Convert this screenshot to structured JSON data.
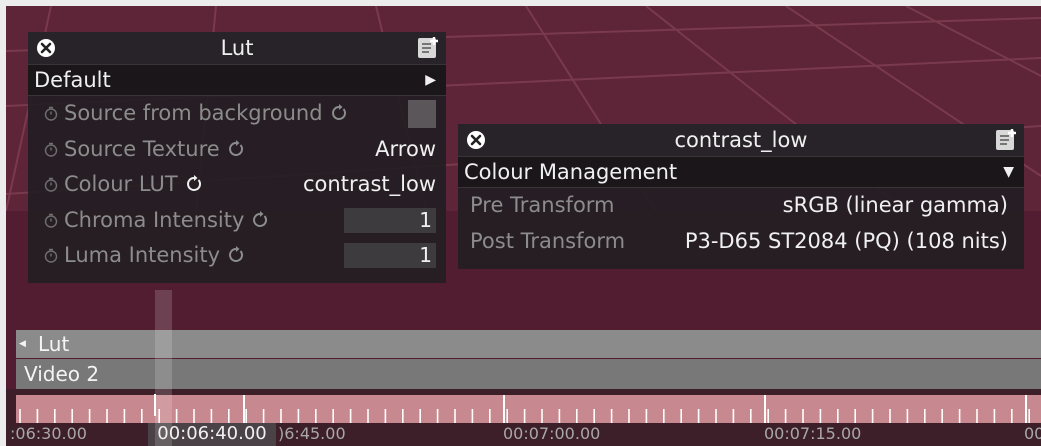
{
  "lut_panel": {
    "title": "Lut",
    "preset": "Default",
    "params": [
      {
        "label": "Source from background",
        "control": "checkbox",
        "checked": false
      },
      {
        "label": "Source Texture",
        "control": "text",
        "value": "Arrow"
      },
      {
        "label": "Colour LUT",
        "control": "text",
        "value": "contrast_low"
      },
      {
        "label": "Chroma Intensity",
        "control": "number",
        "value": "1"
      },
      {
        "label": "Luma Intensity",
        "control": "number",
        "value": "1"
      }
    ]
  },
  "contrast_panel": {
    "title": "contrast_low",
    "section": "Colour Management",
    "rows": [
      {
        "label": "Pre Transform",
        "value": "sRGB (linear gamma)"
      },
      {
        "label": "Post Transform",
        "value": "P3-D65 ST2084 (PQ) (108 nits)"
      }
    ]
  },
  "timeline": {
    "tracks": [
      {
        "label": "Lut",
        "has_arrow": true
      },
      {
        "label": "Video 2",
        "has_arrow": false
      }
    ],
    "timecodes": [
      ":06:30.00",
      "00:06:40.00",
      ")6:45.00",
      "00:07:00.00",
      "00:07:15.00",
      "00"
    ],
    "current_time": "00:06:40.00"
  },
  "colors": {
    "background": "#5e2438",
    "panel": "#221e22",
    "track_lut": "#8b8b8b",
    "track_video": "#787878",
    "ruler": "#c8888f"
  }
}
